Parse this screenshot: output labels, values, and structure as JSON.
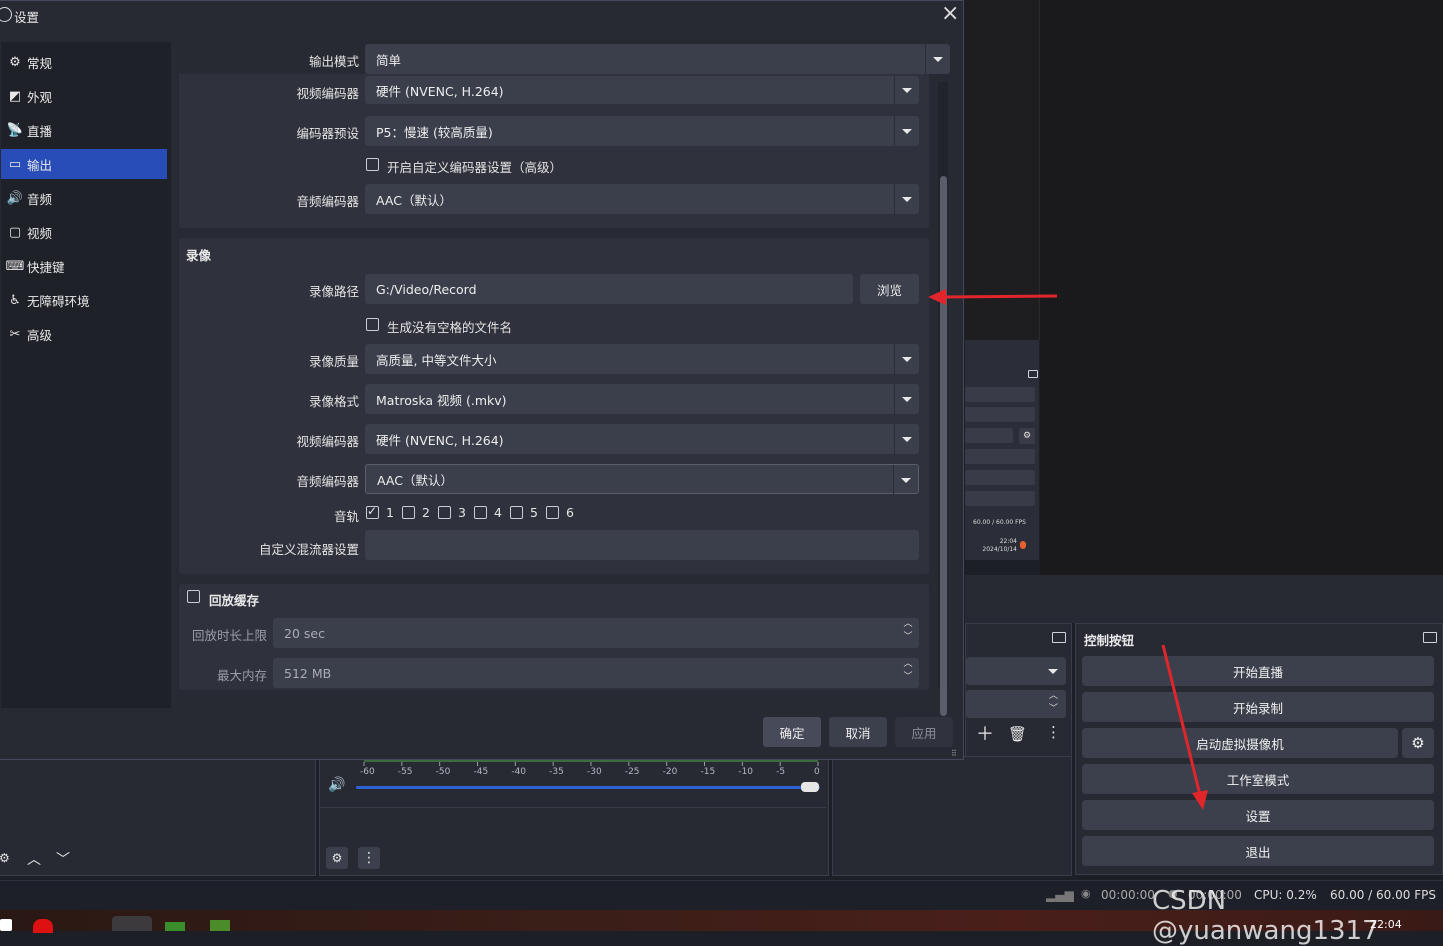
{
  "dialog": {
    "title": "设置",
    "close": "×"
  },
  "sidebar": {
    "items": [
      {
        "icon": "gear-icon",
        "glyph": "⚙",
        "label": "常规"
      },
      {
        "icon": "appearance-icon",
        "glyph": "◩",
        "label": "外观"
      },
      {
        "icon": "broadcast-icon",
        "glyph": "📡",
        "label": "直播"
      },
      {
        "icon": "output-icon",
        "glyph": "▭",
        "label": "输出"
      },
      {
        "icon": "speaker-icon",
        "glyph": "🔊",
        "label": "音频"
      },
      {
        "icon": "monitor-icon",
        "glyph": "▢",
        "label": "视频"
      },
      {
        "icon": "keyboard-icon",
        "glyph": "⌨",
        "label": "快捷键"
      },
      {
        "icon": "accessibility-icon",
        "glyph": "♿",
        "label": "无障碍环境"
      },
      {
        "icon": "tools-icon",
        "glyph": "✂",
        "label": "高级"
      }
    ],
    "active_index": 3
  },
  "streaming": {
    "output_mode_label": "输出模式",
    "output_mode_value": "简单",
    "video_encoder_label": "视频编码器",
    "video_encoder_value": "硬件 (NVENC, H.264)",
    "encoder_preset_label": "编码器预设",
    "encoder_preset_value": "P5：慢速 (较高质量)",
    "custom_encoder_checkbox": "开启自定义编码器设置（高级）",
    "audio_encoder_label": "音频编码器",
    "audio_encoder_value": "AAC（默认）"
  },
  "recording": {
    "section_title": "录像",
    "path_label": "录像路径",
    "path_value": "G:/Video/Record",
    "browse_button": "浏览",
    "no_space_checkbox": "生成没有空格的文件名",
    "quality_label": "录像质量",
    "quality_value": "高质量, 中等文件大小",
    "format_label": "录像格式",
    "format_value": "Matroska 视频 (.mkv)",
    "video_encoder_label": "视频编码器",
    "video_encoder_value": "硬件 (NVENC, H.264)",
    "audio_encoder_label": "音频编码器",
    "audio_encoder_value": "AAC（默认）",
    "tracks_label": "音轨",
    "tracks": [
      {
        "n": "1",
        "checked": true
      },
      {
        "n": "2",
        "checked": false
      },
      {
        "n": "3",
        "checked": false
      },
      {
        "n": "4",
        "checked": false
      },
      {
        "n": "5",
        "checked": false
      },
      {
        "n": "6",
        "checked": false
      }
    ],
    "mixer_label": "自定义混流器设置",
    "mixer_value": ""
  },
  "replay": {
    "section_title": "回放缓存",
    "max_time_label": "回放时长上限",
    "max_time_value": "20 sec",
    "max_memory_label": "最大内存",
    "max_memory_value": "512 MB"
  },
  "footer": {
    "ok": "确定",
    "cancel": "取消",
    "apply": "应用"
  },
  "controls": {
    "title": "控制按钮",
    "start_streaming": "开始直播",
    "start_recording": "开始录制",
    "virtual_camera": "启动虚拟摄像机",
    "studio_mode": "工作室模式",
    "settings": "设置",
    "exit": "退出"
  },
  "mini_stats": {
    "fps": "60.00 / 60.00 FPS",
    "time": "22:04",
    "date": "2024/10/14"
  },
  "mixer": {
    "ticks": [
      "-60",
      "-55",
      "-50",
      "-45",
      "-40",
      "-35",
      "-30",
      "-25",
      "-20",
      "-15",
      "-10",
      "-5",
      "0"
    ],
    "volume_fraction": 1.0
  },
  "statusbar": {
    "stream_time": "00:00:00",
    "record_time": "00:00:00",
    "cpu": "CPU: 0.2%",
    "fps": "60.00 / 60.00 FPS"
  },
  "taskbar": {
    "time": "22:04"
  },
  "watermark": "CSDN @yuanwang1317",
  "colors": {
    "accent": "#284cb8",
    "annotation_arrow": "#e0252b"
  }
}
